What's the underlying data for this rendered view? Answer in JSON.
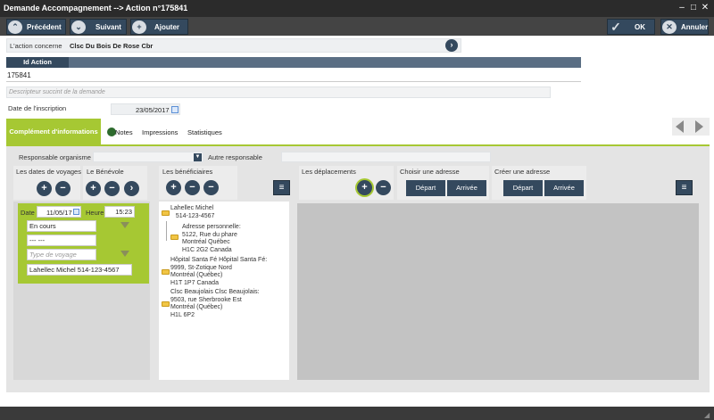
{
  "window": {
    "title": "Demande Accompagnement --> Action n°175841"
  },
  "toolbar": {
    "previous": "Précédent",
    "next": "Suivant",
    "add": "Ajouter",
    "ok": "OK",
    "cancel": "Annuler"
  },
  "action": {
    "concern_label": "L'action concerne",
    "concern_value": "Clsc Du Bois De Rose Cbr",
    "id_header": "Id Action",
    "id_value": "175841",
    "descriptor_placeholder": "Descripteur succint de la demande",
    "inscription_label": "Date de l'inscription",
    "inscription_date": "23/05/2017"
  },
  "tabs": {
    "complement": "Complément d'informations",
    "notes": "Notes",
    "impressions": "Impressions",
    "stats": "Statistiques"
  },
  "responsables": {
    "org_label": "Responsable organisme",
    "other_label": "Autre responsable"
  },
  "panels": {
    "dates_title": "Les dates de voyages",
    "benevole_title": "Le Bénévole",
    "benef_title": "Les bénéficiaires",
    "deplacements_title": "Les déplacements",
    "choose_addr_title": "Choisir une adresse",
    "create_addr_title": "Créer une adresse",
    "depart": "Départ",
    "arrivee": "Arrivée"
  },
  "voyage": {
    "date_label": "Date",
    "date_value": "11/05/17",
    "hour_label": "Heure",
    "hour_value": "15:23",
    "status": "En cours",
    "dash": "--- ---",
    "type_placeholder": "Type de voyage",
    "benevole": "Lahellec Michel   514-123-4567"
  },
  "beneficiaires": [
    {
      "lines": [
        "Lahellec Michel",
        "   514-123-4567"
      ]
    },
    {
      "lines": [
        "Adresse personnelle:",
        "5122, Rue du phare",
        "Montréal Québec",
        "H1C 2G2 Canada"
      ]
    },
    {
      "lines": [
        "Hôpital Santa Fé Hôpital Santa Fé:",
        "9999, St-Zotique Nord",
        "Montréal (Québec)",
        "H1T 1P7 Canada"
      ]
    },
    {
      "lines": [
        "Clsc Beaujolais Clsc Beaujolais:",
        "9503, rue Sherbrooke Est",
        "Montréal (Québec)",
        "H1L 6P2"
      ]
    }
  ],
  "colors": {
    "accent_green": "#a6c833",
    "navy": "#34495e"
  }
}
